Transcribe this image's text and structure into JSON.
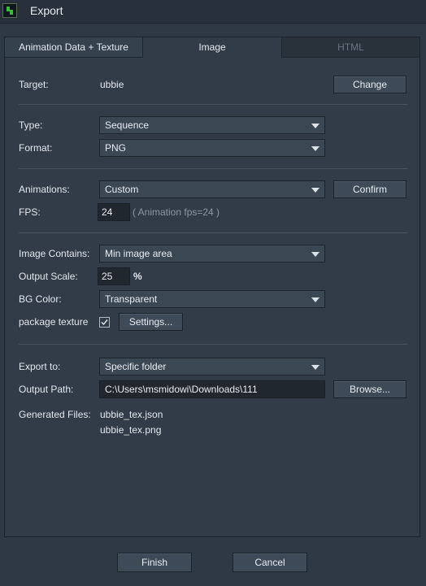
{
  "window": {
    "title": "Export",
    "icon": "app-logo-icon"
  },
  "tabs": [
    {
      "label": "Animation Data + Texture",
      "state": "inactive"
    },
    {
      "label": "Image",
      "state": "active"
    },
    {
      "label": "HTML",
      "state": "disabled"
    }
  ],
  "target": {
    "label": "Target:",
    "value": "ubbie",
    "button": "Change"
  },
  "type": {
    "label": "Type:",
    "selected": "Sequence"
  },
  "format": {
    "label": "Format:",
    "selected": "PNG"
  },
  "animations": {
    "label": "Animations:",
    "selected": "Custom",
    "button": "Confirm"
  },
  "fps": {
    "label": "FPS:",
    "value": "24",
    "hint": "( Animation fps=24 )"
  },
  "image_contains": {
    "label": "Image Contains:",
    "selected": "Min image area"
  },
  "output_scale": {
    "label": "Output Scale:",
    "value": "25",
    "unit": "%"
  },
  "bg_color": {
    "label": "BG Color:",
    "selected": "Transparent"
  },
  "package_texture": {
    "label": "package texture",
    "checked": true,
    "button": "Settings..."
  },
  "export_to": {
    "label": "Export to:",
    "selected": "Specific folder"
  },
  "output_path": {
    "label": "Output Path:",
    "value": "C:\\Users\\msmidowi\\Downloads\\111",
    "button": "Browse..."
  },
  "generated_files": {
    "label": "Generated Files:",
    "files": [
      "ubbie_tex.json",
      "ubbie_tex.png"
    ]
  },
  "footer": {
    "finish": "Finish",
    "cancel": "Cancel"
  },
  "colors": {
    "background": "#2f3845",
    "panel": "#323c48",
    "input_bg": "#20272f",
    "text": "#e4e8ec",
    "hint": "#8a96a3"
  }
}
